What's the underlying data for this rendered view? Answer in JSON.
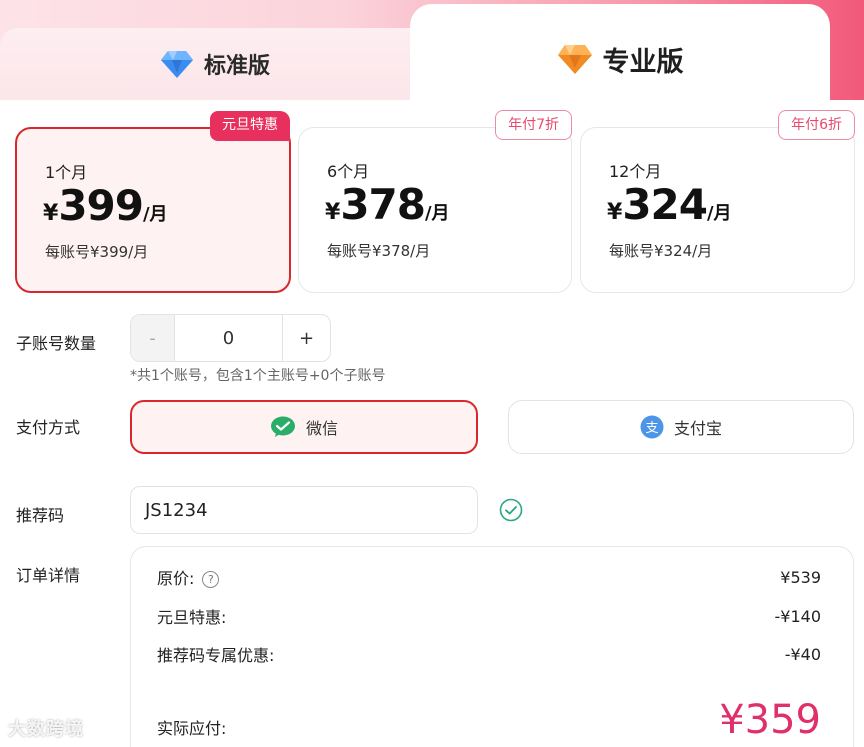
{
  "tabs": {
    "standard": {
      "label": "标准版",
      "icon": "blue-diamond-icon"
    },
    "pro": {
      "label": "专业版",
      "icon": "orange-diamond-icon"
    }
  },
  "plans": [
    {
      "badge": "元旦特惠",
      "duration": "1个月",
      "currency": "¥",
      "amount": "399",
      "unit": "/月",
      "per_account": "每账号¥399/月",
      "selected": true
    },
    {
      "badge": "年付7折",
      "duration": "6个月",
      "currency": "¥",
      "amount": "378",
      "unit": "/月",
      "per_account": "每账号¥378/月",
      "selected": false
    },
    {
      "badge": "年付6折",
      "duration": "12个月",
      "currency": "¥",
      "amount": "324",
      "unit": "/月",
      "per_account": "每账号¥324/月",
      "selected": false
    }
  ],
  "sub_accounts": {
    "label": "子账号数量",
    "minus": "-",
    "value": "0",
    "plus": "+",
    "hint": "*共1个账号，包含1个主账号+0个子账号"
  },
  "payment": {
    "label": "支付方式",
    "wechat": "微信",
    "alipay": "支付宝",
    "alipay_glyph": "支"
  },
  "referral": {
    "label": "推荐码",
    "value": "JS1234"
  },
  "order": {
    "label": "订单详情",
    "original_label": "原价:",
    "original_value": "¥539",
    "help_glyph": "?",
    "promo_label": "元旦特惠:",
    "promo_value": "-¥140",
    "referral_label": "推荐码专属优惠:",
    "referral_value": "-¥40",
    "total_label": "实际应付:",
    "total_value": "¥359"
  },
  "watermark": "大数跨境",
  "colors": {
    "accent_red": "#d9272e",
    "badge_pink": "#e8305e",
    "total_pink": "#e0306a",
    "wechat_green": "#2aae67",
    "alipay_blue": "#1677ff",
    "check_teal": "#2aa884"
  }
}
